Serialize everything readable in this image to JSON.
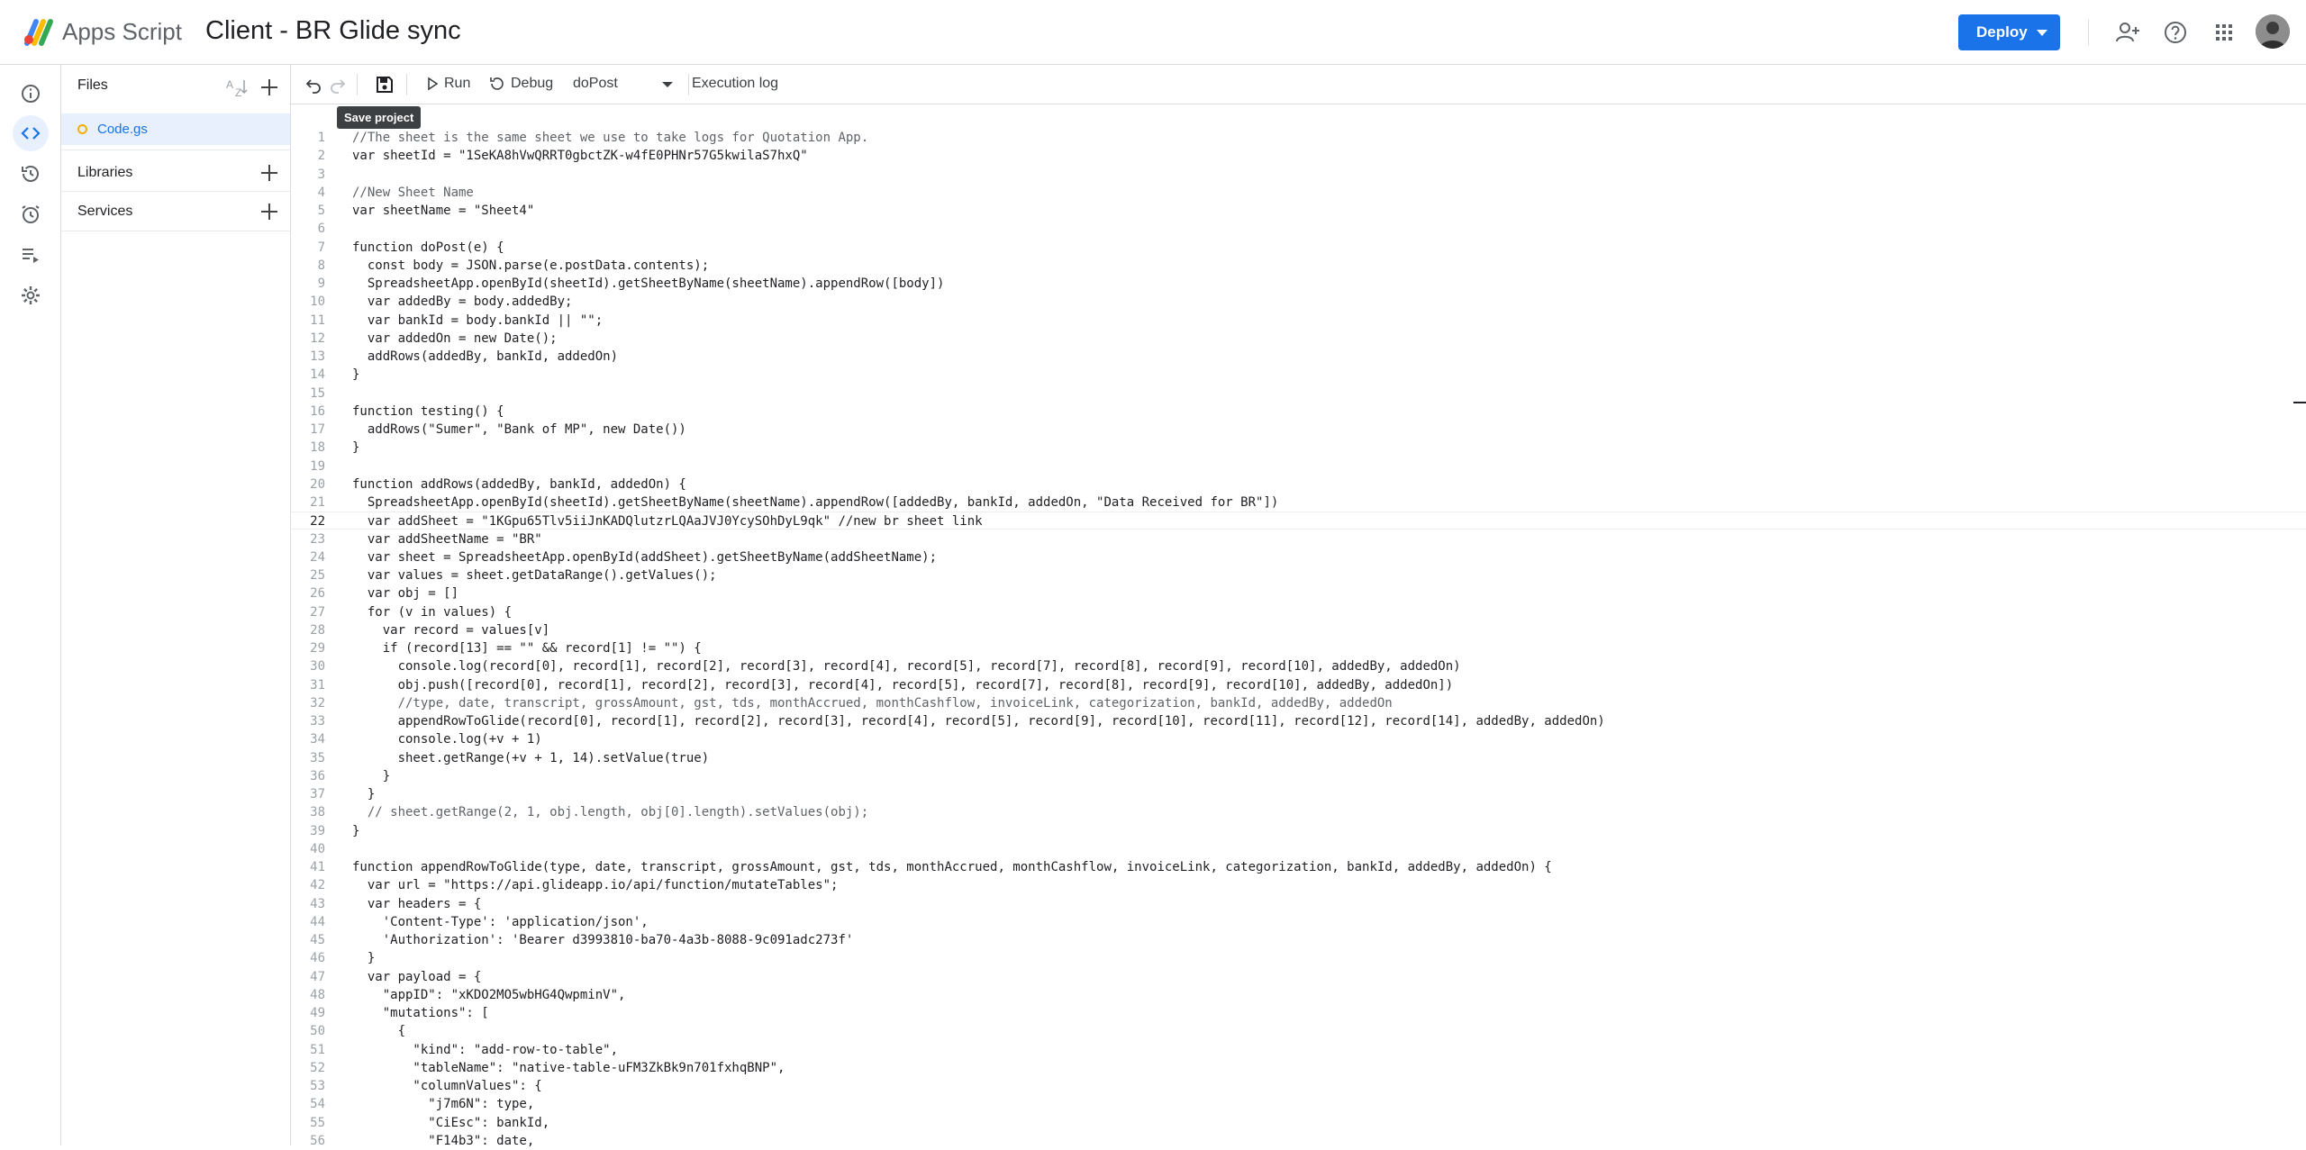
{
  "header": {
    "brand": "Apps Script",
    "project_title": "Client - BR Glide sync",
    "deploy_label": "Deploy"
  },
  "files_panel": {
    "title": "Files",
    "file_name": "Code.gs",
    "libraries_label": "Libraries",
    "services_label": "Services"
  },
  "toolbar": {
    "run_label": "Run",
    "debug_label": "Debug",
    "function_select": "doPost",
    "execution_log_label": "Execution log",
    "tooltip": "Save project"
  },
  "editor": {
    "current_line": 22,
    "lines": [
      "//The sheet is the same sheet we use to take logs for Quotation App.",
      "var sheetId = \"1SeKA8hVwQRRT0gbctZK-w4fE0PHNr57G5kwilaS7hxQ\"",
      "",
      "//New Sheet Name",
      "var sheetName = \"Sheet4\"",
      "",
      "function doPost(e) {",
      "  const body = JSON.parse(e.postData.contents);",
      "  SpreadsheetApp.openById(sheetId).getSheetByName(sheetName).appendRow([body])",
      "  var addedBy = body.addedBy;",
      "  var bankId = body.bankId || \"\";",
      "  var addedOn = new Date();",
      "  addRows(addedBy, bankId, addedOn)",
      "}",
      "",
      "function testing() {",
      "  addRows(\"Sumer\", \"Bank of MP\", new Date())",
      "}",
      "",
      "function addRows(addedBy, bankId, addedOn) {",
      "  SpreadsheetApp.openById(sheetId).getSheetByName(sheetName).appendRow([addedBy, bankId, addedOn, \"Data Received for BR\"])",
      "  var addSheet = \"1KGpu65Tlv5iiJnKADQlutzrLQAaJVJ0YcySOhDyL9qk\" //new br sheet link",
      "  var addSheetName = \"BR\"",
      "  var sheet = SpreadsheetApp.openById(addSheet).getSheetByName(addSheetName);",
      "  var values = sheet.getDataRange().getValues();",
      "  var obj = []",
      "  for (v in values) {",
      "    var record = values[v]",
      "    if (record[13] == \"\" && record[1] != \"\") {",
      "      console.log(record[0], record[1], record[2], record[3], record[4], record[5], record[7], record[8], record[9], record[10], addedBy, addedOn)",
      "      obj.push([record[0], record[1], record[2], record[3], record[4], record[5], record[7], record[8], record[9], record[10], addedBy, addedOn])",
      "      //type, date, transcript, grossAmount, gst, tds, monthAccrued, monthCashflow, invoiceLink, categorization, bankId, addedBy, addedOn",
      "      appendRowToGlide(record[0], record[1], record[2], record[3], record[4], record[5], record[9], record[10], record[11], record[12], record[14], addedBy, addedOn)",
      "      console.log(+v + 1)",
      "      sheet.getRange(+v + 1, 14).setValue(true)",
      "    }",
      "  }",
      "  // sheet.getRange(2, 1, obj.length, obj[0].length).setValues(obj);",
      "}",
      "",
      "function appendRowToGlide(type, date, transcript, grossAmount, gst, tds, monthAccrued, monthCashflow, invoiceLink, categorization, bankId, addedBy, addedOn) {",
      "  var url = \"https://api.glideapp.io/api/function/mutateTables\";",
      "  var headers = {",
      "    'Content-Type': 'application/json',",
      "    'Authorization': 'Bearer d3993810-ba70-4a3b-8088-9c091adc273f'",
      "  }",
      "  var payload = {",
      "    \"appID\": \"xKDO2MO5wbHG4QwpminV\",",
      "    \"mutations\": [",
      "      {",
      "        \"kind\": \"add-row-to-table\",",
      "        \"tableName\": \"native-table-uFM3ZkBk9n701fxhqBNP\",",
      "        \"columnValues\": {",
      "          \"j7m6N\": type,",
      "          \"CiEsc\": bankId,",
      "          \"F14b3\": date,"
    ]
  }
}
